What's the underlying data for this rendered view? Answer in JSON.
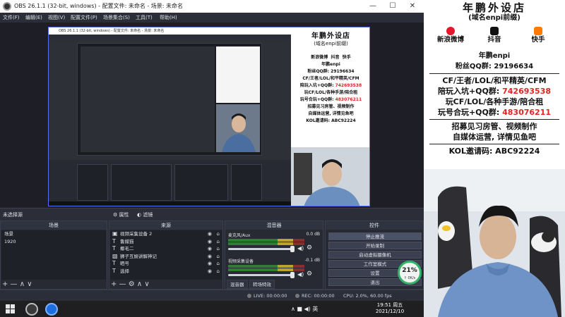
{
  "window": {
    "title": "OBS 26.1.1 (32-bit, windows) - 配置文件: 未命名 - 场景: 未命名",
    "controls": [
      "—",
      "☐",
      "✕"
    ]
  },
  "menu": {
    "items": [
      "文件(F)",
      "编辑(E)",
      "视图(V)",
      "配置文件(P)",
      "场景集合(S)",
      "工具(T)",
      "帮助(H)"
    ]
  },
  "preview": {
    "inner_title": "OBS 26.1.1 (32-bit, windows) - 配置文件: 未命名 - 场景: 未命名",
    "inner_card": {
      "title": "年鹏外设店",
      "subtitle": "(域名enpi前缀)",
      "social": [
        "新浪微博",
        "抖音",
        "快手"
      ],
      "name": "年鹏enpi",
      "qq": "粉丝QQ群: 29196634",
      "line1": "CF/王者/LOL/和平精英/CFM",
      "line2a": "陪玩入坑+QQ群: ",
      "line2b": "742693538",
      "line3": "玩CF/LOL/各种手游/陪合租",
      "line4a": "玩号合玩+QQ群: ",
      "line4b": "483076211",
      "line5": "招募见习房管、视频制作",
      "line6": "自媒体运营, 详情见鱼吧",
      "kol": "KOL邀请码: ABC92224"
    }
  },
  "source_bar": {
    "label": "未选择源",
    "properties": "属性",
    "filters": "滤镜"
  },
  "scenes": {
    "header": "场景",
    "items": [
      "场景",
      "1920"
    ],
    "footer": "+ — ∧ ∨"
  },
  "sources": {
    "header": "来源",
    "items": [
      {
        "icon": "camera-icon",
        "label": "视频采集设备 2"
      },
      {
        "icon": "text-icon",
        "label": "鲁媒猫"
      },
      {
        "icon": "text-icon",
        "label": "椰毛二"
      },
      {
        "icon": "image-icon",
        "label": "狮子互娱讲解神记"
      },
      {
        "icon": "text-icon",
        "label": "晒号"
      },
      {
        "icon": "text-icon",
        "label": "选择"
      }
    ],
    "footer": "+ — ⚙ ∧ ∨"
  },
  "mixer": {
    "header": "混音器",
    "tracks": [
      {
        "name": "麦克风/Aux",
        "db": "0.0 dB"
      },
      {
        "name": "视频采集设备",
        "db": "-0.1 dB"
      }
    ],
    "tabs": [
      "混音器",
      "转场特效"
    ]
  },
  "controls": {
    "header": "控件",
    "buttons": [
      "停止推流",
      "开始录制",
      "启动虚拟摄像机",
      "工作室模式",
      "设置",
      "退出"
    ]
  },
  "cpu_gauge": {
    "percent": "21%",
    "speed": "↑ 0K/s"
  },
  "status": {
    "live": "LIVE: 00:00:00",
    "rec": "REC: 00:00:00",
    "cpu": "CPU: 2.0%, 60.00 fps"
  },
  "taskbar": {
    "tray": "∧  ■  ◀)  英",
    "time": "19:51 周五",
    "date": "2021/12/10"
  },
  "promo": {
    "title": "年鹏外设店",
    "subtitle": "(域名enpi前缀)",
    "social": [
      "新浪微博",
      "抖音",
      "快手"
    ],
    "name": "年鹏enpi",
    "qq": "粉丝QQ群: 29196634",
    "line1": "CF/王者/LOL/和平精英/CFM",
    "line2a": "陪玩入坑+QQ群: ",
    "line2b": "742693538",
    "line3": "玩CF/LOL/各种手游/陪合租",
    "line4a": "玩号合玩+QQ群: ",
    "line4b": "483076211",
    "line5": "招募见习房管、视频制作",
    "line6": "自媒体运营, 详情见鱼吧",
    "kol": "KOL邀请码: ABC92224",
    "accent_red": "#e02424",
    "weibo_color": "#e6162d",
    "douyin_color": "#111111",
    "kuaishou_color": "#ff7a00"
  }
}
